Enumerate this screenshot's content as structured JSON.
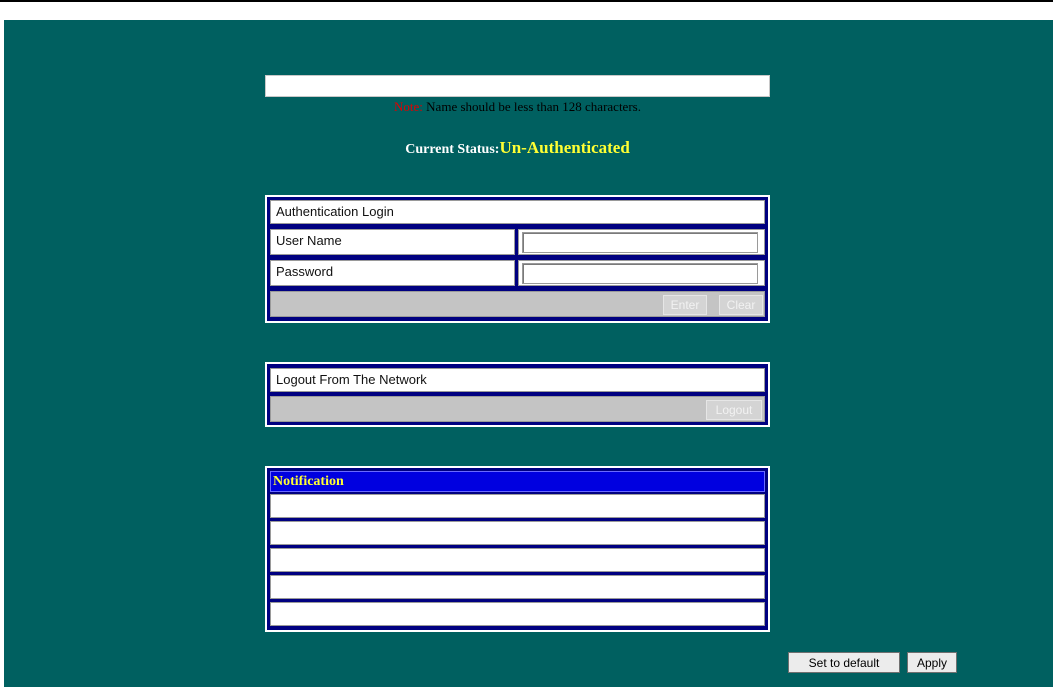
{
  "name_field": {
    "value": ""
  },
  "note": {
    "label": "Note:",
    "text": " Name should be less than 128 characters."
  },
  "status": {
    "label": "Current Status:",
    "value": "Un-Authenticated"
  },
  "auth_login": {
    "title": "Authentication Login",
    "username_label": "User Name",
    "password_label": "Password",
    "username_value": "",
    "password_value": "",
    "enter_label": "Enter",
    "clear_label": "Clear"
  },
  "logout": {
    "title": "Logout From The Network",
    "button_label": "Logout"
  },
  "notification": {
    "header": "Notification",
    "rows": [
      "",
      "",
      "",
      "",
      ""
    ]
  },
  "footer": {
    "set_default_label": "Set to default",
    "apply_label": "Apply"
  },
  "colors": {
    "background": "#006060",
    "box_border": "#000080",
    "note_label": "#e00000",
    "status_value": "#ffff33",
    "notification_header_bg": "#0000e0"
  }
}
